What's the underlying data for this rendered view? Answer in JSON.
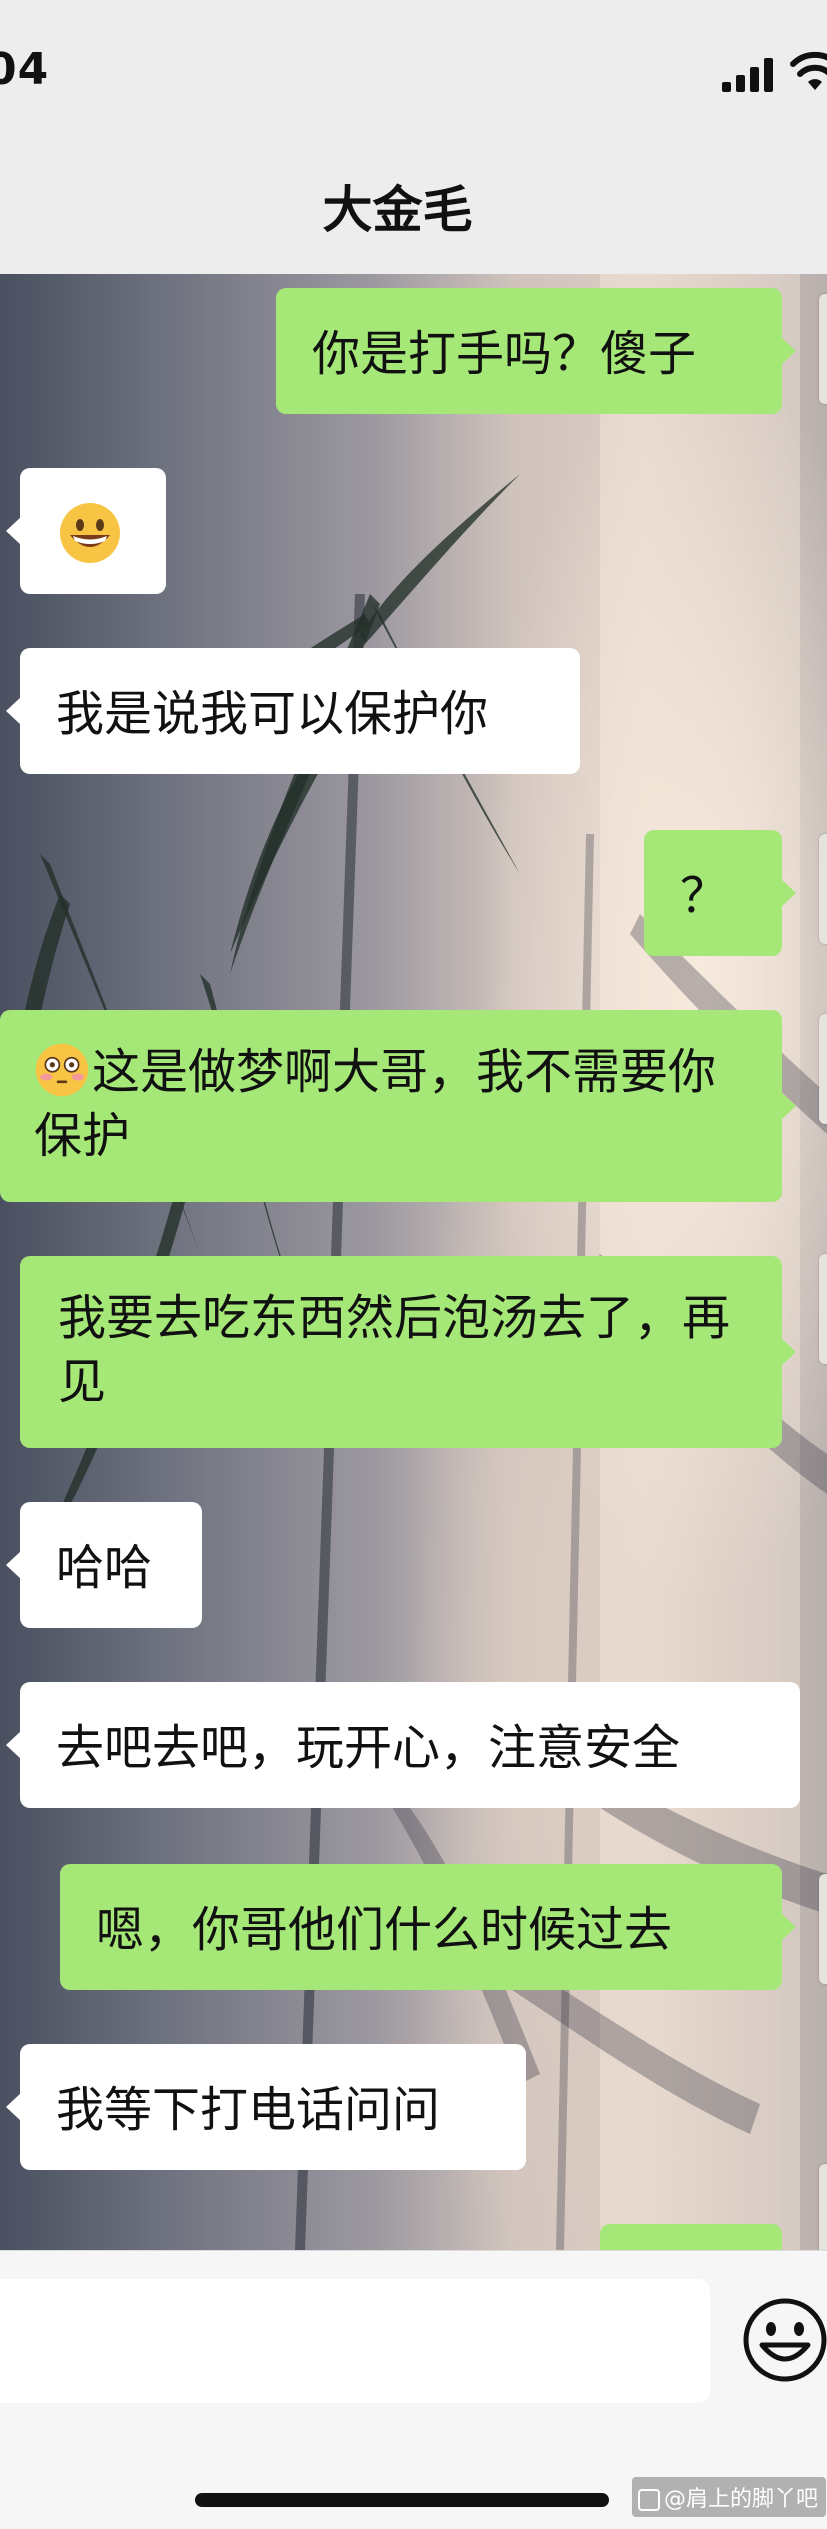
{
  "status_bar": {
    "time": "04",
    "signal_icon": "cellular-signal-icon",
    "wifi_icon": "wifi-icon"
  },
  "header": {
    "title": "大金毛"
  },
  "messages": [
    {
      "side": "sent",
      "text": "你是打手吗？傻子"
    },
    {
      "side": "received",
      "text": "",
      "emoji": "grinning-face-icon"
    },
    {
      "side": "received",
      "text": "我是说我可以保护你"
    },
    {
      "side": "sent",
      "text": "？"
    },
    {
      "side": "sent",
      "text": "这是做梦啊大哥，我不需要你保护",
      "emoji": "flushed-face-icon"
    },
    {
      "side": "sent",
      "text": "我要去吃东西然后泡汤去了，再见"
    },
    {
      "side": "received",
      "text": "哈哈"
    },
    {
      "side": "received",
      "text": "去吧去吧，玩开心，注意安全"
    },
    {
      "side": "sent",
      "text": "嗯，你哥他们什么时候过去"
    },
    {
      "side": "received",
      "text": "我等下打电话问问"
    },
    {
      "side": "sent",
      "text": ""
    }
  ],
  "input_bar": {
    "value": "",
    "emoji_button_icon": "smiley-icon"
  },
  "watermark": {
    "text": "@肩上的脚丫吧"
  },
  "colors": {
    "sent_bubble": "#a5e878",
    "received_bubble": "#ffffff",
    "bar_background": "#ededed"
  }
}
